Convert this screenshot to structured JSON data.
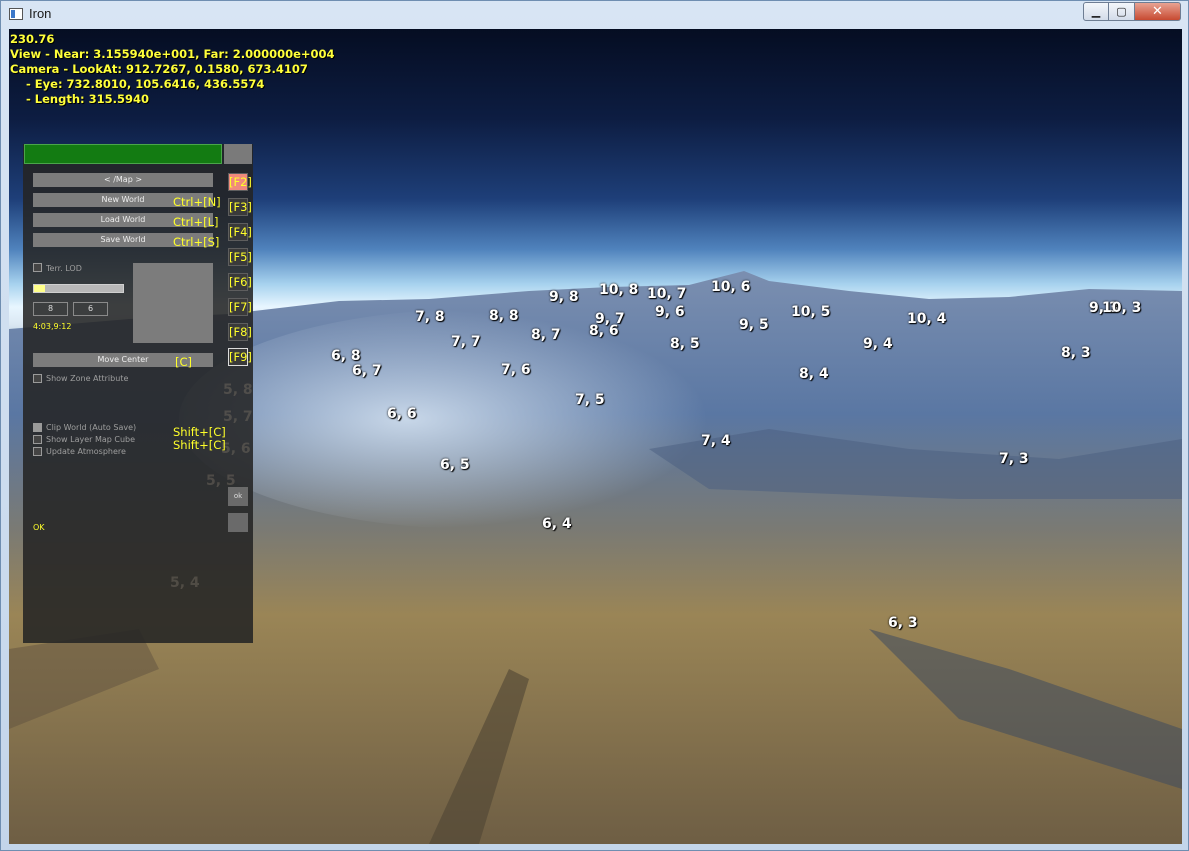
{
  "window": {
    "title": "Iron",
    "minimize_glyph": "▁",
    "maximize_glyph": "▢",
    "close_glyph": "✕"
  },
  "hud": {
    "fps": "230.76",
    "view": "View - Near: 3.155940e+001, Far: 2.000000e+004",
    "camera_lookat": "Camera - LookAt: 912.7267, 0.1580, 673.4107",
    "camera_eye": "    - Eye: 732.8010, 105.6416, 436.5574",
    "camera_length": "    - Length: 315.5940"
  },
  "panel": {
    "map_button": "< /Map >",
    "new_world": "New World",
    "new_world_shortcut": "Ctrl+[N]",
    "load_world": "Load World",
    "load_world_shortcut": "Ctrl+[L]",
    "save_world": "Save World",
    "save_world_shortcut": "Ctrl+[S]",
    "terr_lod": "Terr. LOD",
    "lod_slider_level": 0.12,
    "field_x": "8",
    "field_y": "6",
    "coord_readout": "4:03,9:12",
    "move_center": "Move Center",
    "move_center_shortcut": "[C]",
    "show_zone_attribute": "Show Zone Attribute",
    "clip_world": "Clip World (Auto Save)",
    "clip_world_shortcut": "Shift+[C]",
    "show_layer_map_cube": "Show Layer Map Cube",
    "show_layer_map_cube_shortcut": "Shift+[C]",
    "update_atmosphere": "Update Atmosphere",
    "status": "OK",
    "side_small_button": "ok"
  },
  "fkeys": [
    "[F2]",
    "[F3]",
    "[F4]",
    "[F5]",
    "[F6]",
    "[F7]",
    "[F8]",
    "[F9]"
  ],
  "grid_labels": {
    "l_9_8": "9, 8",
    "l_10_8": "10, 8",
    "l_10_7": "10, 7",
    "l_10_6": "10, 6",
    "l_7_8": "7, 8",
    "l_8_8": "8, 8",
    "l_9_7": "9, 7",
    "l_8_6": "8, 6",
    "l_9_6": "9, 6",
    "l_10_5": "10, 5",
    "l_9_5": "9, 5",
    "l_10_4": "10, 4",
    "l_9_3": "9, 3",
    "l_10_3": "10, 3",
    "l_8_7": "8, 7",
    "l_7_7": "7, 7",
    "l_8_5": "8, 5",
    "l_9_4": "9, 4",
    "l_8_3": "8, 3",
    "l_6_8": "6, 8",
    "l_6_7": "6, 7",
    "l_7_6": "7, 6",
    "l_8_4": "8, 4",
    "l_7_5": "7, 5",
    "l_6_6": "6, 6",
    "l_7_4": "7, 4",
    "l_6_5": "6, 5",
    "l_7_3": "7, 3",
    "l_6_4": "6, 4",
    "l_6_3": "6, 3",
    "faint_5_8": "5, 8",
    "faint_5_7": "5, 7",
    "faint_5_6": "5, 6",
    "faint_5_5": "5, 5",
    "faint_5_4": "5, 4"
  }
}
